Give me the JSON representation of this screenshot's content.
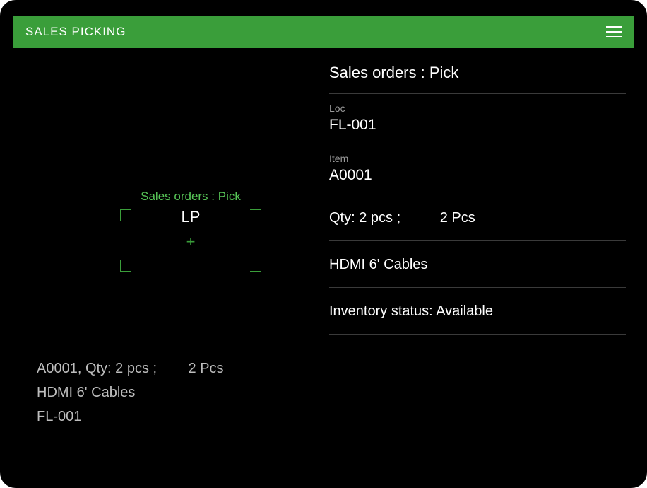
{
  "header": {
    "title": "SALES PICKING"
  },
  "scan": {
    "title": "Sales orders : Pick",
    "lp_label": "LP"
  },
  "summary": {
    "line1": "A0001, Qty: 2 pcs ;        2 Pcs",
    "line2": "HDMI 6' Cables",
    "line3": "FL-001"
  },
  "panel": {
    "title": "Sales orders : Pick",
    "loc_label": "Loc",
    "loc_value": "FL-001",
    "item_label": "Item",
    "item_value": "A0001",
    "qty_line": "Qty: 2 pcs ;          2 Pcs",
    "desc": "HDMI 6' Cables",
    "inventory_status": "Inventory status: Available"
  }
}
